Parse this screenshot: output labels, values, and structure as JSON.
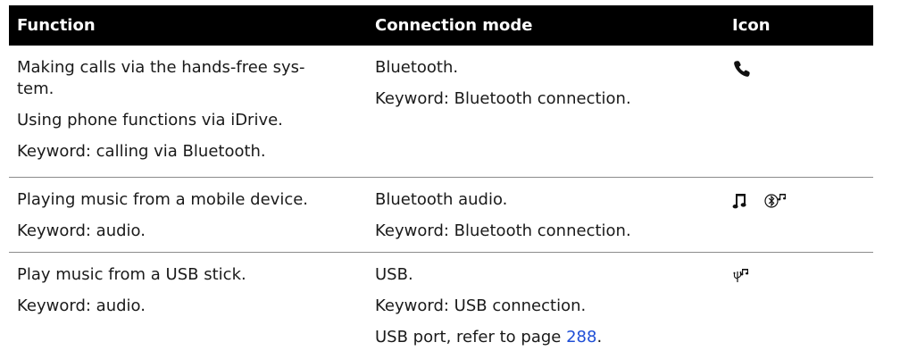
{
  "table": {
    "headers": {
      "function": "Function",
      "connection_mode": "Connection mode",
      "icon": "Icon"
    },
    "rows": [
      {
        "function": [
          "Making calls via the hands-free sys-",
          "tem.",
          "Using phone functions via iDrive.",
          "Keyword: calling via Bluetooth."
        ],
        "connection_mode": [
          "Bluetooth.",
          "Keyword: Bluetooth connection."
        ],
        "icons": [
          "phone-handset-icon"
        ]
      },
      {
        "function": [
          "Playing music from a mobile device.",
          "Keyword: audio."
        ],
        "connection_mode": [
          "Bluetooth audio.",
          "Keyword: Bluetooth connection."
        ],
        "icons": [
          "music-note-icon",
          "bluetooth-audio-icon"
        ]
      },
      {
        "function": [
          "Play music from a USB stick.",
          "Keyword: audio."
        ],
        "connection_mode": [
          "USB.",
          "Keyword: USB connection."
        ],
        "connection_mode_ref": {
          "text": "USB port, refer to page ",
          "page": "288",
          "suffix": "."
        },
        "icons": [
          "usb-audio-icon"
        ]
      }
    ]
  },
  "colors": {
    "header_bg": "#000000",
    "header_text": "#ffffff",
    "link": "#1f4fd6",
    "divider": "#8c8c8c"
  }
}
